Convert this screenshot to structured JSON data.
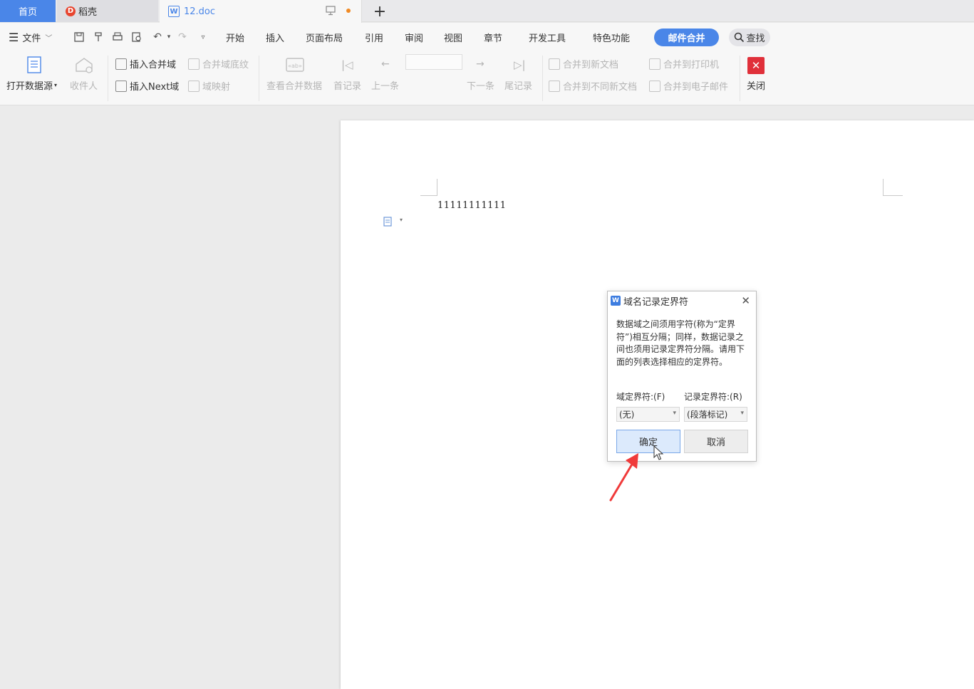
{
  "tabs": {
    "home": "首页",
    "daoke": "稻壳",
    "doc": "12.doc",
    "add": "+"
  },
  "menu": {
    "file": "文件",
    "items": [
      "开始",
      "插入",
      "页面布局",
      "引用",
      "审阅",
      "视图",
      "章节",
      "开发工具",
      "特色功能"
    ],
    "active": "邮件合并",
    "search": "查找"
  },
  "ribbon": {
    "open_data_source": "打开数据源",
    "recipients": "收件人",
    "insert_merge_field": "插入合并域",
    "merge_field_shading": "合并域底纹",
    "insert_next_field": "插入Next域",
    "field_mapping": "域映射",
    "view_merged_data": "查看合并数据",
    "first_record": "首记录",
    "prev_record": "上一条",
    "next_record": "下一条",
    "last_record": "尾记录",
    "merge_to_new_doc": "合并到新文档",
    "merge_to_diff_docs": "合并到不同新文档",
    "merge_to_printer": "合并到打印机",
    "merge_to_email": "合并到电子邮件",
    "close": "关闭"
  },
  "document": {
    "text": "11111111111"
  },
  "dialog": {
    "title": "域名记录定界符",
    "description": "数据域之间须用字符(称为“定界符”)相互分隔；同样，数据记录之间也须用记录定界符分隔。请用下面的列表选择相应的定界符。",
    "field_label": "域定界符:(F)",
    "record_label": "记录定界符:(R)",
    "field_value": "(无)",
    "record_value": "(段落标记)",
    "ok": "确定",
    "cancel": "取消"
  },
  "colors": {
    "accent": "#4a86e8",
    "close_red": "#e0303a",
    "arrow_red": "#f03a3a"
  }
}
